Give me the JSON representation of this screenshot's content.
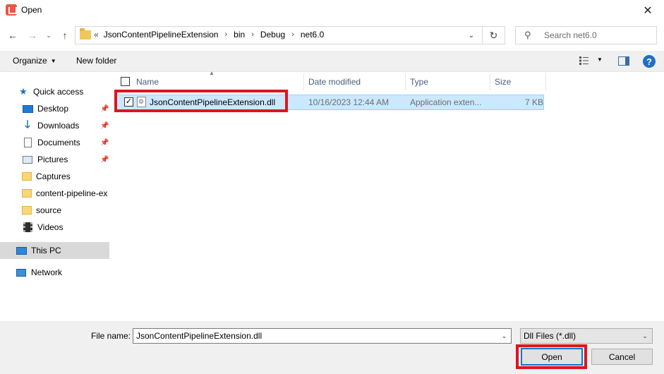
{
  "window": {
    "title": "Open",
    "close_glyph": "✕"
  },
  "nav_buttons": {
    "back": "←",
    "forward": "→",
    "recent": "⌄",
    "up": "↑"
  },
  "address": {
    "prefix": "«",
    "crumbs": [
      "JsonContentPipelineExtension",
      "bin",
      "Debug",
      "net6.0"
    ],
    "separator": "›",
    "dropdown_glyph": "⌄",
    "refresh_glyph": "↻"
  },
  "search": {
    "placeholder": "Search net6.0",
    "icon": "search-icon"
  },
  "toolbar": {
    "organize_label": "Organize",
    "new_folder_label": "New folder",
    "caret": "▼",
    "help_label": "?"
  },
  "sidebar": {
    "items": [
      {
        "label": "Quick access",
        "icon": "star-icon",
        "pinned": false
      },
      {
        "label": "Desktop",
        "icon": "desktop-icon",
        "pinned": true
      },
      {
        "label": "Downloads",
        "icon": "downloads-icon",
        "pinned": true
      },
      {
        "label": "Documents",
        "icon": "documents-icon",
        "pinned": true
      },
      {
        "label": "Pictures",
        "icon": "pictures-icon",
        "pinned": true
      },
      {
        "label": "Captures",
        "icon": "folder-icon",
        "pinned": false
      },
      {
        "label": "content-pipeline-ex",
        "icon": "folder-icon",
        "pinned": false
      },
      {
        "label": "source",
        "icon": "folder-icon",
        "pinned": false
      },
      {
        "label": "Videos",
        "icon": "videos-icon",
        "pinned": false
      },
      {
        "label": "This PC",
        "icon": "pc-icon",
        "pinned": false,
        "selected": true
      },
      {
        "label": "Network",
        "icon": "network-icon",
        "pinned": false
      }
    ]
  },
  "columns": {
    "name": "Name",
    "date_modified": "Date modified",
    "type": "Type",
    "size": "Size"
  },
  "files": [
    {
      "name": "JsonContentPipelineExtension.dll",
      "date_modified": "10/16/2023 12:44 AM",
      "type": "Application exten...",
      "size": "7 KB",
      "checked": true,
      "selected": true
    }
  ],
  "footer": {
    "file_name_label": "File name:",
    "file_name_value": "JsonContentPipelineExtension.dll",
    "file_type_value": "Dll Files (*.dll)",
    "dropdown_glyph": "⌄",
    "open_label": "Open",
    "cancel_label": "Cancel"
  },
  "colors": {
    "selection": "#cce8ff",
    "highlight": "#e0141e",
    "accent": "#0078d7"
  }
}
